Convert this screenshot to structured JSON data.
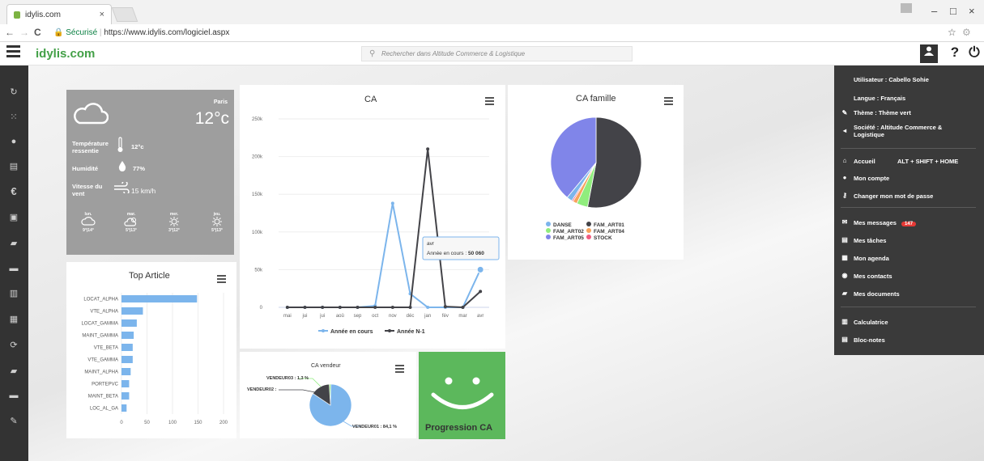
{
  "browser": {
    "tab_title": "idylis.com",
    "tab_close": "×",
    "url_secure": "Sécurisé",
    "url": "https://www.idylis.com/logiciel.aspx",
    "back": "←",
    "forward": "→",
    "reload": "C",
    "star": "☆",
    "win_min": "–",
    "win_max": "□",
    "win_close": "×"
  },
  "app": {
    "logo": "idylis.com",
    "search_placeholder": "Rechercher dans Altitude Commerce & Logistique",
    "help_icon": "?",
    "power_icon": "⏻"
  },
  "weather": {
    "city": "Paris",
    "temp": "12°c",
    "feel_label": "Température ressentie",
    "feel_value": "12°c",
    "humidity_label": "Humidité",
    "humidity_value": "77%",
    "wind_label": "Vitesse du vent",
    "wind_value": "15 km/h",
    "forecast": [
      {
        "day": "lun.",
        "range": "9°|14°"
      },
      {
        "day": "mar.",
        "range": "5°|13°"
      },
      {
        "day": "mer.",
        "range": "3°|12°"
      },
      {
        "day": "jeu.",
        "range": "5°|13°"
      }
    ]
  },
  "right_panel": {
    "user": "Utilisateur : Cabello Sohie",
    "lang": "Langue : Français",
    "theme": "Thème : Thème vert",
    "society": "Société : Altitude Commerce & Logistique",
    "home": "Accueil",
    "home_shortcut": "ALT + SHIFT + HOME",
    "account": "Mon compte",
    "password": "Changer mon mot de passe",
    "messages": "Mes messages",
    "messages_count": "147",
    "tasks": "Mes tâches",
    "agenda": "Mon agenda",
    "contacts": "Mes contacts",
    "documents": "Mes documents",
    "calculator": "Calculatrice",
    "notepad": "Bloc-notes"
  },
  "top_article": {
    "title": "Top Article"
  },
  "ca_vendeur": {
    "title": "CA vendeur"
  },
  "progression": {
    "label": "Progression CA"
  },
  "chart_data": [
    {
      "type": "line",
      "title": "CA",
      "categories": [
        "mai",
        "jui",
        "jui",
        "aoû",
        "sep",
        "oct",
        "nov",
        "déc",
        "jan",
        "fév",
        "mar",
        "avr"
      ],
      "ylim": [
        0,
        250000
      ],
      "yticks": [
        "0",
        "50k",
        "100k",
        "150k",
        "200k",
        "250k"
      ],
      "series": [
        {
          "name": "Année en cours",
          "color": "#7cb5ec",
          "values": [
            0,
            0,
            0,
            0,
            0,
            2000,
            138000,
            18000,
            0,
            0,
            0,
            50060
          ]
        },
        {
          "name": "Année N-1",
          "color": "#434348",
          "values": [
            0,
            0,
            0,
            0,
            0,
            0,
            0,
            0,
            210000,
            1000,
            0,
            21000
          ]
        }
      ],
      "tooltip": {
        "category": "avr",
        "series": "Année en cours",
        "value_label": "50 060"
      },
      "legend": "bottom"
    },
    {
      "type": "pie",
      "title": "CA famille",
      "slices": [
        {
          "name": "DANSE",
          "color": "#7cb5ec",
          "value": 2
        },
        {
          "name": "FAM_ART01",
          "color": "#434348",
          "value": 53
        },
        {
          "name": "FAM_ART02",
          "color": "#90ed7d",
          "value": 4
        },
        {
          "name": "FAM_ART04",
          "color": "#f7a35c",
          "value": 1.5
        },
        {
          "name": "FAM_ART05",
          "color": "#8085e9",
          "value": 39
        },
        {
          "name": "STOCK",
          "color": "#f15c80",
          "value": 0.5
        }
      ],
      "legend": "bottom"
    },
    {
      "type": "bar",
      "title": "Top Article",
      "categories": [
        "LOCAT_ALPHA",
        "VTE_ALPHA",
        "LOCAT_GAMMA",
        "MAINT_GAMMA",
        "VTE_BETA",
        "VTE_GAMMA",
        "MAINT_ALPHA",
        "PORTEPVC",
        "MAINT_BETA",
        "LOC_AL_GA"
      ],
      "values": [
        148,
        42,
        30,
        24,
        22,
        22,
        18,
        15,
        15,
        10
      ],
      "xlim": [
        0,
        200
      ],
      "xticks": [
        "0",
        "50",
        "100",
        "150",
        "200"
      ],
      "color": "#7cb5ec"
    },
    {
      "type": "pie",
      "title": "CA vendeur",
      "slices": [
        {
          "name": "VENDEUR01",
          "label": "VENDEUR01 : 84,1 %",
          "color": "#7cb5ec",
          "value": 84.1
        },
        {
          "name": "VENDEUR02",
          "label": "VENDEUR02 :",
          "color": "#434348",
          "value": 14.6
        },
        {
          "name": "VENDEUR03",
          "label": "VENDEUR03 : 1,3 %",
          "color": "#90ed7d",
          "value": 1.3
        }
      ]
    }
  ]
}
